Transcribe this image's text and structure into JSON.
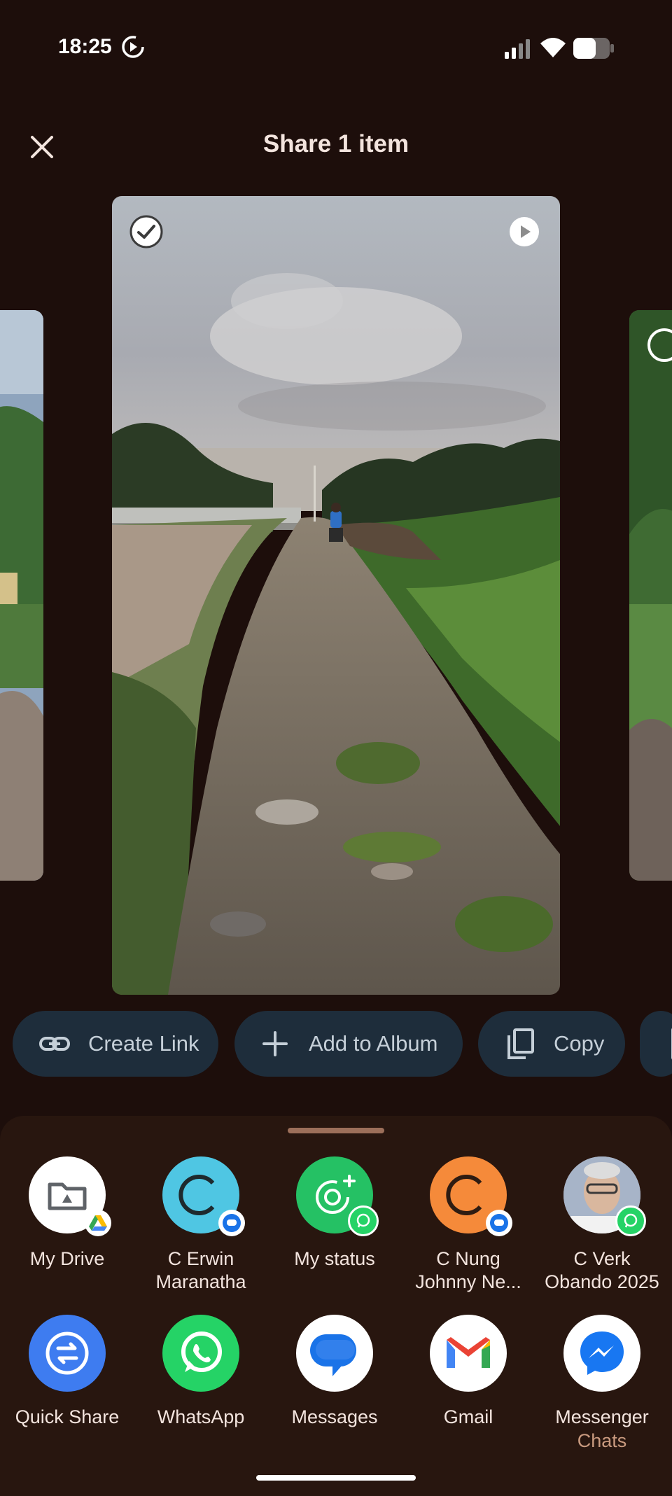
{
  "status_bar": {
    "time": "18:25",
    "icons": [
      "screen-record-icon",
      "signal-icon",
      "wifi-icon",
      "battery-icon"
    ]
  },
  "header": {
    "title": "Share 1 item",
    "close_icon": "close-icon"
  },
  "gallery": {
    "selected_badge_icon": "check-icon",
    "play_icon": "play-icon"
  },
  "actions": [
    {
      "label": "Create Link",
      "icon": "link-icon"
    },
    {
      "label": "Add to Album",
      "icon": "plus-icon"
    },
    {
      "label": "Copy",
      "icon": "copy-icon"
    }
  ],
  "share_targets_row1": [
    {
      "label": "My Drive",
      "sub": "",
      "icon": "google-drive-folder-icon",
      "bg": "#ffffff"
    },
    {
      "label": "C Erwin",
      "sub": "Maranatha",
      "icon": "contact-c-icon",
      "bg": "#4fc6e3"
    },
    {
      "label": "My status",
      "sub": "",
      "icon": "status-icon",
      "bg": "#25c164"
    },
    {
      "label": "C Nung",
      "sub": "Johnny Ne...",
      "icon": "contact-c-icon",
      "bg": "#f58a3a"
    },
    {
      "label": "C Verk",
      "sub": "Obando 2025",
      "icon": "contact-photo",
      "bg": "#c8c3c6"
    }
  ],
  "share_targets_row2": [
    {
      "label": "Quick Share",
      "sub": "",
      "icon": "quick-share-icon",
      "bg": "#3e7cf0"
    },
    {
      "label": "WhatsApp",
      "sub": "",
      "icon": "whatsapp-icon",
      "bg": "#25d366"
    },
    {
      "label": "Messages",
      "sub": "",
      "icon": "messages-icon",
      "bg": "#ffffff"
    },
    {
      "label": "Gmail",
      "sub": "",
      "icon": "gmail-icon",
      "bg": "#ffffff"
    },
    {
      "label": "Messenger",
      "sub": "Chats",
      "icon": "messenger-icon",
      "bg": "#ffffff"
    }
  ],
  "colors": {
    "background": "#1d0e0b",
    "sheet": "#28160f",
    "chip": "#1e2d3b",
    "accent_sub": "#c99a7f"
  }
}
